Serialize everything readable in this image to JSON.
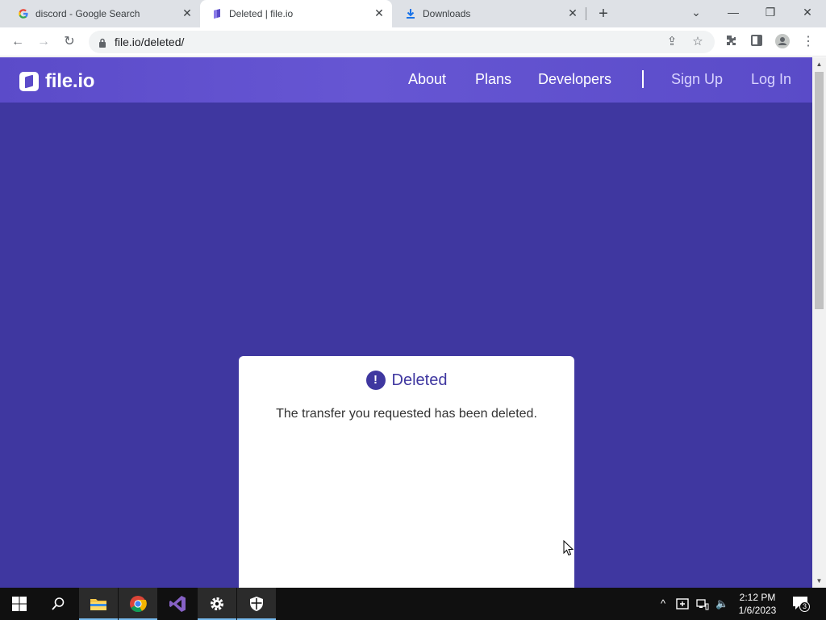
{
  "browser": {
    "tabs": [
      {
        "title": "discord - Google Search",
        "favicon": "google-favicon-icon",
        "active": false
      },
      {
        "title": "Deleted | file.io",
        "favicon": "fileio-favicon-icon",
        "active": true
      },
      {
        "title": "Downloads",
        "favicon": "download-icon",
        "active": false
      }
    ],
    "url": "file.io/deleted/"
  },
  "site": {
    "logo_text": "file.io",
    "nav": {
      "about": "About",
      "plans": "Plans",
      "developers": "Developers",
      "signup": "Sign Up",
      "login": "Log In"
    },
    "colors": {
      "background": "#3f37a0",
      "navbar": "#5b4bc9",
      "card": "#ffffff"
    }
  },
  "card": {
    "title": "Deleted",
    "message": "The transfer you requested has been deleted."
  },
  "taskbar": {
    "time": "2:12 PM",
    "date": "1/6/2023",
    "notification_count": "3"
  }
}
